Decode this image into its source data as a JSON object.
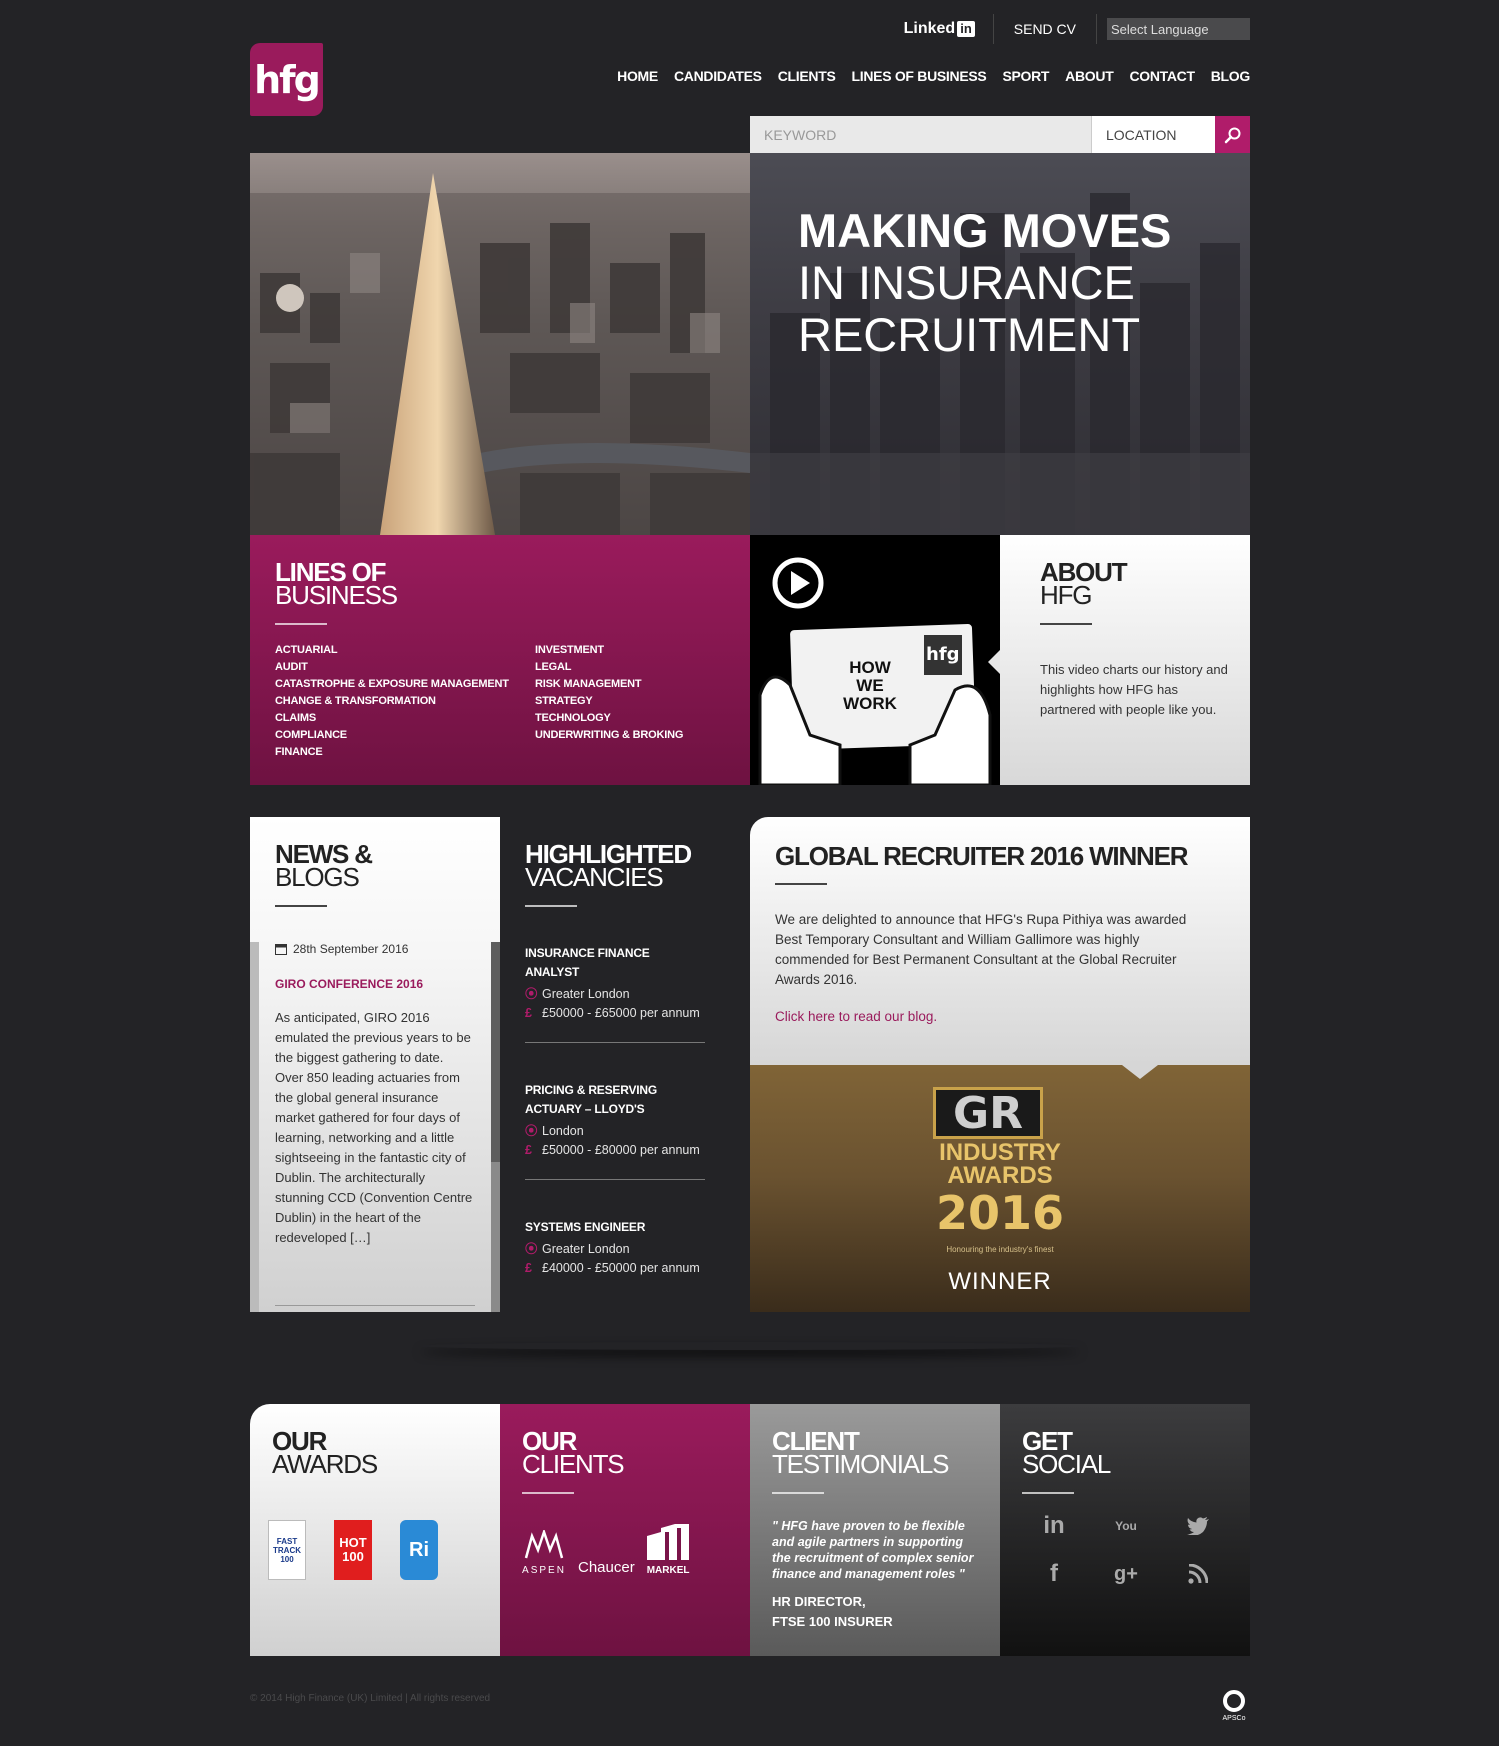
{
  "topbar": {
    "linkedin_text": "Linked",
    "linkedin_box": "in",
    "send_cv": "SEND CV",
    "language": "Select Language"
  },
  "logo": "hfg",
  "nav": [
    "HOME",
    "CANDIDATES",
    "CLIENTS",
    "LINES OF BUSINESS",
    "SPORT",
    "ABOUT",
    "CONTACT",
    "BLOG"
  ],
  "search": {
    "keyword_placeholder": "KEYWORD",
    "location_placeholder": "LOCATION",
    "button_icon": "search-icon"
  },
  "hero": {
    "line1": "MAKING MOVES",
    "line2": "IN INSURANCE",
    "line3": "RECRUITMENT"
  },
  "lines_of_business": {
    "title_bold": "LINES OF",
    "title_light": "BUSINESS",
    "col1": [
      "ACTUARIAL",
      "AUDIT",
      "CATASTROPHE & EXPOSURE MANAGEMENT",
      "CHANGE & TRANSFORMATION",
      "CLAIMS",
      "COMPLIANCE",
      "FINANCE"
    ],
    "col2": [
      "INVESTMENT",
      "LEGAL",
      "RISK MANAGEMENT",
      "STRATEGY",
      "TECHNOLOGY",
      "UNDERWRITING & BROKING"
    ]
  },
  "video": {
    "card_line1": "HOW",
    "card_line2": "WE",
    "card_line3": "WORK",
    "card_logo": "hfg",
    "play_icon": "play-icon"
  },
  "about": {
    "title_bold": "ABOUT",
    "title_light": "HFG",
    "text": "This video charts our history and highlights how HFG has partnered with people like you."
  },
  "news": {
    "title_bold": "NEWS &",
    "title_light": "BLOGS",
    "date": "28th September 2016",
    "post_title": "GIRO CONFERENCE 2016",
    "excerpt": "As anticipated, GIRO 2016 emulated the previous years to be the biggest gathering to date. Over 850 leading actuaries from the global general insurance market gathered for four days of learning, networking and a little sightseeing in the fantastic city of Dublin.  The architecturally stunning CCD (Convention Centre Dublin) in the heart of the redeveloped […]"
  },
  "vacancies": {
    "title_bold": "HIGHLIGHTED",
    "title_light": "VACANCIES",
    "jobs": [
      {
        "title": "INSURANCE FINANCE ANALYST",
        "location": "Greater London",
        "salary": "£50000 - £65000 per annum"
      },
      {
        "title": "PRICING & RESERVING ACTUARY – LLOYD'S",
        "location": "London",
        "salary": "£50000 - £80000 per annum"
      },
      {
        "title": "SYSTEMS ENGINEER",
        "location": "Greater London",
        "salary": "£40000 - £50000 per annum"
      }
    ]
  },
  "award": {
    "title": "GLOBAL RECRUITER 2016 WINNER",
    "text": "We are delighted to announce that HFG's Rupa Pithiya was awarded Best Temporary Consultant and William Gallimore was highly commended for Best Permanent Consultant at the Global Recruiter Awards 2016.",
    "link": "Click here to read our blog.",
    "logo": "GR",
    "industry": "INDUSTRY",
    "awards": "AWARDS",
    "year": "2016",
    "honouring": "Honouring the industry's finest",
    "winner": "WINNER"
  },
  "bottom": {
    "awards": {
      "title_bold": "OUR",
      "title_light": "AWARDS",
      "badge1": "FAST TRACK 100",
      "badge2": "HOT 100",
      "badge3": "Ri"
    },
    "clients": {
      "title_bold": "OUR",
      "title_light": "CLIENTS",
      "logo1": "ASPEN",
      "logo2": "Chaucer",
      "logo3": "MARKEL"
    },
    "testimonials": {
      "title_bold": "CLIENT",
      "title_light": "TESTIMONIALS",
      "quote": "\" HFG have proven to be flexible and agile partners in supporting the recruitment of complex senior finance and management roles \"",
      "sig1": "HR DIRECTOR,",
      "sig2": "FTSE 100 INSURER"
    },
    "social": {
      "title_bold": "GET",
      "title_light": "SOCIAL",
      "icons": [
        "in",
        "You",
        "t",
        "f",
        "g+",
        "rss"
      ]
    }
  },
  "footer": {
    "copyright": "© 2014 High Finance (UK) Limited | All rights reserved",
    "apsco": "APSCo"
  },
  "colors": {
    "brand": "#9a1b5c",
    "background": "#232326",
    "search_button": "#b01c6a"
  }
}
